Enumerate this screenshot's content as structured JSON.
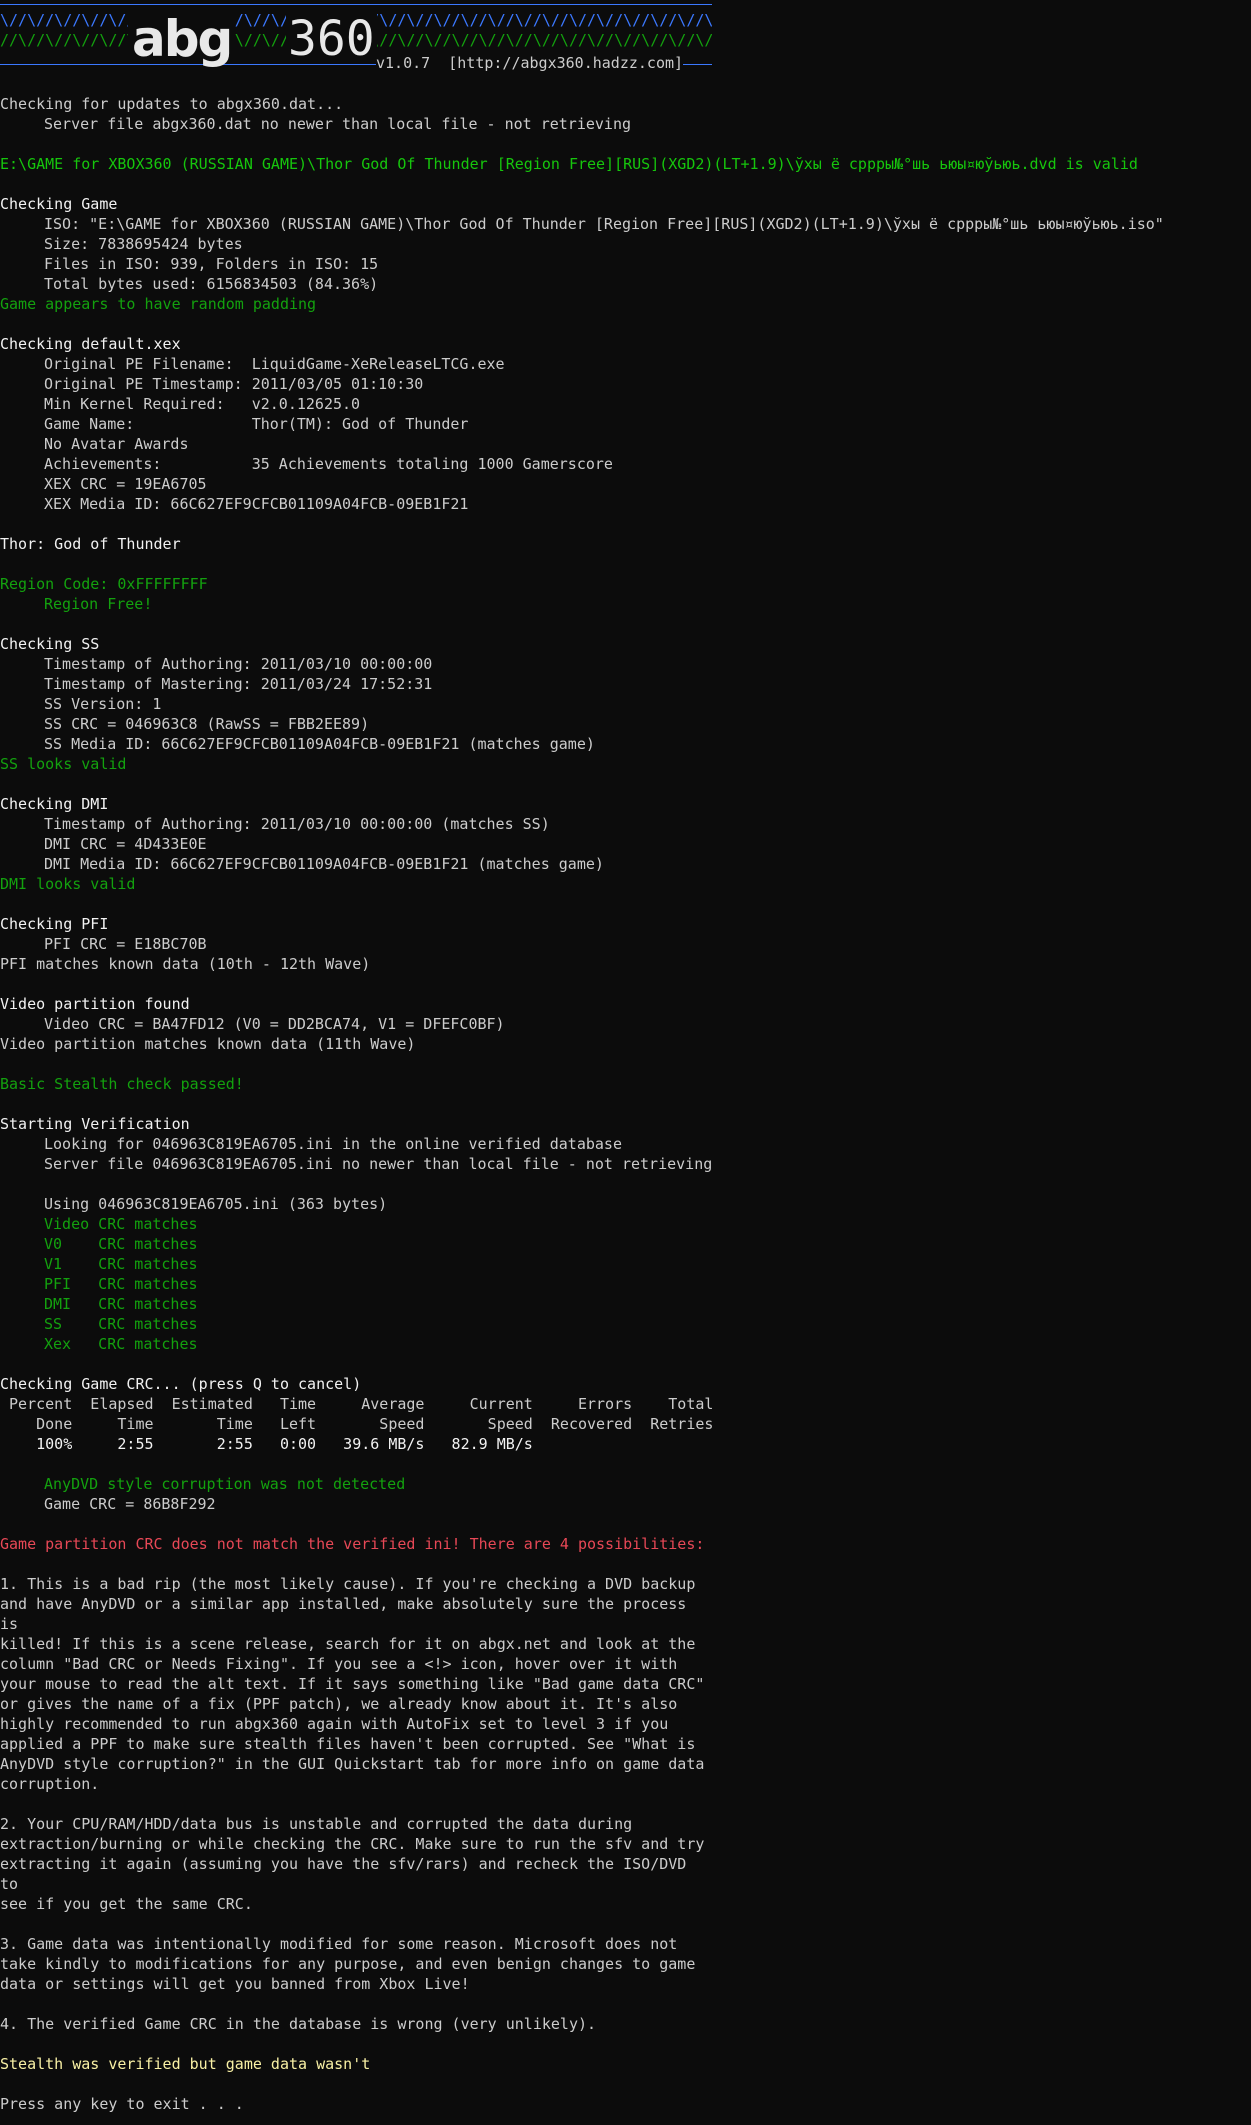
{
  "banner": {
    "pattern_top": "\\//\\//\\//\\//\\//\\//\\//\\//\\//\\//\\//\\//\\//\\//\\//\\//\\//\\//\\//\\//\\//\\//\\//\\//\\//\\//\\//\\//\\//\\//\\//\\//\\//\\//\\//",
    "pattern_bottom": "//\\//\\//\\//\\//\\//\\//\\//\\//\\//\\//\\//\\//\\//\\//\\//\\//\\//\\//\\//\\//\\//\\//\\//\\//\\//\\//\\//\\//\\//\\//\\//\\//\\//\\//\\",
    "logo_left": "abg",
    "logo_right": "360",
    "version_url": "v1.0.7  [http://abgx360.hadzz.com]"
  },
  "lines": [
    {
      "text": "Checking for updates to abgx360.dat...",
      "color": "gray",
      "indent": 0
    },
    {
      "text": "Server file abgx360.dat no newer than local file - not retrieving",
      "color": "gray",
      "indent": 1
    },
    {
      "text": "",
      "color": "gray",
      "indent": 0
    },
    {
      "text": "E:\\GAME for XBOX360 (RUSSIAN GAME)\\Thor God Of Thunder [Region Free][RUS](XGD2)(LT+1.9)\\ўхы ё сррры№°шь ьюы¤юўьюь.dvd is valid",
      "color": "green",
      "indent": 0
    },
    {
      "text": "",
      "color": "gray",
      "indent": 0
    },
    {
      "text": "Checking Game",
      "color": "white",
      "indent": 0
    },
    {
      "text": "ISO: \"E:\\GAME for XBOX360 (RUSSIAN GAME)\\Thor God Of Thunder [Region Free][RUS](XGD2)(LT+1.9)\\ўхы ё сррры№°шь ьюы¤юўьюь.iso\"",
      "color": "gray",
      "indent": 1
    },
    {
      "text": "Size: 7838695424 bytes",
      "color": "gray",
      "indent": 1
    },
    {
      "text": "Files in ISO: 939, Folders in ISO: 15",
      "color": "gray",
      "indent": 1
    },
    {
      "text": "Total bytes used: 6156834503 (84.36%)",
      "color": "gray",
      "indent": 1
    },
    {
      "text": "Game appears to have random padding",
      "color": "dgreen",
      "indent": 0
    },
    {
      "text": "",
      "color": "gray",
      "indent": 0
    },
    {
      "text": "Checking default.xex",
      "color": "white",
      "indent": 0
    },
    {
      "text": "Original PE Filename:  LiquidGame-XeReleaseLTCG.exe",
      "color": "gray",
      "indent": 1
    },
    {
      "text": "Original PE Timestamp: 2011/03/05 01:10:30",
      "color": "gray",
      "indent": 1
    },
    {
      "text": "Min Kernel Required:   v2.0.12625.0",
      "color": "gray",
      "indent": 1
    },
    {
      "text": "Game Name:             Thor(TM): God of Thunder",
      "color": "gray",
      "indent": 1
    },
    {
      "text": "No Avatar Awards",
      "color": "gray",
      "indent": 1
    },
    {
      "text": "Achievements:          35 Achievements totaling 1000 Gamerscore",
      "color": "gray",
      "indent": 1
    },
    {
      "text": "XEX CRC = 19EA6705",
      "color": "gray",
      "indent": 1
    },
    {
      "text": "XEX Media ID: 66C627EF9CFCB01109A04FCB-09EB1F21",
      "color": "gray",
      "indent": 1
    },
    {
      "text": "",
      "color": "gray",
      "indent": 0
    },
    {
      "text": "Thor: God of Thunder",
      "color": "white",
      "indent": 0
    },
    {
      "text": "",
      "color": "gray",
      "indent": 0
    },
    {
      "text": "Region Code: 0xFFFFFFFF",
      "color": "dgreen",
      "indent": 0
    },
    {
      "text": "Region Free!",
      "color": "dgreen",
      "indent": 1
    },
    {
      "text": "",
      "color": "gray",
      "indent": 0
    },
    {
      "text": "Checking SS",
      "color": "white",
      "indent": 0
    },
    {
      "text": "Timestamp of Authoring: 2011/03/10 00:00:00",
      "color": "gray",
      "indent": 1
    },
    {
      "text": "Timestamp of Mastering: 2011/03/24 17:52:31",
      "color": "gray",
      "indent": 1
    },
    {
      "text": "SS Version: 1",
      "color": "gray",
      "indent": 1
    },
    {
      "text": "SS CRC = 046963C8 (RawSS = FBB2EE89)",
      "color": "gray",
      "indent": 1
    },
    {
      "text": "SS Media ID: 66C627EF9CFCB01109A04FCB-09EB1F21 (matches game)",
      "color": "gray",
      "indent": 1
    },
    {
      "text": "SS looks valid",
      "color": "dgreen",
      "indent": 0
    },
    {
      "text": "",
      "color": "gray",
      "indent": 0
    },
    {
      "text": "Checking DMI",
      "color": "white",
      "indent": 0
    },
    {
      "text": "Timestamp of Authoring: 2011/03/10 00:00:00 (matches SS)",
      "color": "gray",
      "indent": 1
    },
    {
      "text": "DMI CRC = 4D433E0E",
      "color": "gray",
      "indent": 1
    },
    {
      "text": "DMI Media ID: 66C627EF9CFCB01109A04FCB-09EB1F21 (matches game)",
      "color": "gray",
      "indent": 1
    },
    {
      "text": "DMI looks valid",
      "color": "dgreen",
      "indent": 0
    },
    {
      "text": "",
      "color": "gray",
      "indent": 0
    },
    {
      "text": "Checking PFI",
      "color": "white",
      "indent": 0
    },
    {
      "text": "PFI CRC = E18BC70B",
      "color": "gray",
      "indent": 1
    },
    {
      "text": "PFI matches known data (10th - 12th Wave)",
      "color": "gray",
      "indent": 0
    },
    {
      "text": "",
      "color": "gray",
      "indent": 0
    },
    {
      "text": "Video partition found",
      "color": "white",
      "indent": 0
    },
    {
      "text": "Video CRC = BA47FD12 (V0 = DD2BCA74, V1 = DFEFC0BF)",
      "color": "gray",
      "indent": 1
    },
    {
      "text": "Video partition matches known data (11th Wave)",
      "color": "gray",
      "indent": 0
    },
    {
      "text": "",
      "color": "gray",
      "indent": 0
    },
    {
      "text": "Basic Stealth check passed!",
      "color": "dgreen",
      "indent": 0
    },
    {
      "text": "",
      "color": "gray",
      "indent": 0
    },
    {
      "text": "Starting Verification",
      "color": "white",
      "indent": 0
    },
    {
      "text": "Looking for 046963C819EA6705.ini in the online verified database",
      "color": "gray",
      "indent": 1
    },
    {
      "text": "Server file 046963C819EA6705.ini no newer than local file - not retrieving",
      "color": "gray",
      "indent": 1
    },
    {
      "text": "",
      "color": "gray",
      "indent": 0
    },
    {
      "text": "Using 046963C819EA6705.ini (363 bytes)",
      "color": "gray",
      "indent": 1
    },
    {
      "text": "Video CRC matches",
      "color": "dgreen",
      "indent": 1
    },
    {
      "text": "V0    CRC matches",
      "color": "dgreen",
      "indent": 1
    },
    {
      "text": "V1    CRC matches",
      "color": "dgreen",
      "indent": 1
    },
    {
      "text": "PFI   CRC matches",
      "color": "dgreen",
      "indent": 1
    },
    {
      "text": "DMI   CRC matches",
      "color": "dgreen",
      "indent": 1
    },
    {
      "text": "SS    CRC matches",
      "color": "dgreen",
      "indent": 1
    },
    {
      "text": "Xex   CRC matches",
      "color": "dgreen",
      "indent": 1
    },
    {
      "text": "",
      "color": "gray",
      "indent": 0
    },
    {
      "text": "Checking Game CRC... (press Q to cancel)",
      "color": "white",
      "indent": 0
    },
    {
      "text": " Percent  Elapsed  Estimated   Time     Average     Current     Errors    Total",
      "color": "gray",
      "indent": 0
    },
    {
      "text": "    Done     Time       Time   Left       Speed       Speed  Recovered  Retries",
      "color": "gray",
      "indent": 0
    },
    {
      "text": "    100%     2:55       2:55   0:00   39.6 MB/s   82.9 MB/s",
      "color": "white",
      "indent": 0
    },
    {
      "text": "",
      "color": "gray",
      "indent": 0
    },
    {
      "text": "AnyDVD style corruption was not detected",
      "color": "dgreen",
      "indent": 1
    },
    {
      "text": "Game CRC = 86B8F292",
      "color": "gray",
      "indent": 1
    },
    {
      "text": "",
      "color": "gray",
      "indent": 0
    },
    {
      "text": "Game partition CRC does not match the verified ini! There are 4 possibilities:",
      "color": "red",
      "indent": 0
    },
    {
      "text": "",
      "color": "gray",
      "indent": 0
    }
  ],
  "paragraphs": [
    {
      "text": "1. This is a bad rip (the most likely cause). If you're checking a DVD backup\nand have AnyDVD or a similar app installed, make absolutely sure the process is\nkilled! If this is a scene release, search for it on abgx.net and look at the\ncolumn \"Bad CRC or Needs Fixing\". If you see a <!> icon, hover over it with\nyour mouse to read the alt text. If it says something like \"Bad game data CRC\"\nor gives the name of a fix (PPF patch), we already know about it. It's also\nhighly recommended to run abgx360 again with AutoFix set to level 3 if you\napplied a PPF to make sure stealth files haven't been corrupted. See \"What is\nAnyDVD style corruption?\" in the GUI Quickstart tab for more info on game data\ncorruption.",
      "color": "gray"
    },
    {
      "text": "2. Your CPU/RAM/HDD/data bus is unstable and corrupted the data during\nextraction/burning or while checking the CRC. Make sure to run the sfv and try\nextracting it again (assuming you have the sfv/rars) and recheck the ISO/DVD to\nsee if you get the same CRC.",
      "color": "gray"
    },
    {
      "text": "3. Game data was intentionally modified for some reason. Microsoft does not\ntake kindly to modifications for any purpose, and even benign changes to game\ndata or settings will get you banned from Xbox Live!",
      "color": "gray"
    },
    {
      "text": "4. The verified Game CRC in the database is wrong (very unlikely).",
      "color": "gray"
    }
  ],
  "footer": [
    {
      "text": "Stealth was verified but game data wasn't",
      "color": "yellow"
    },
    {
      "text": "",
      "color": "gray"
    },
    {
      "text": "Press any key to exit . . .",
      "color": "gray"
    }
  ],
  "colors": {
    "background": "#0c0c0c",
    "text": "#cccccc",
    "green": "#13a10e",
    "red": "#e74856",
    "yellow": "#f9f1a5",
    "blue": "#3b78ff"
  }
}
